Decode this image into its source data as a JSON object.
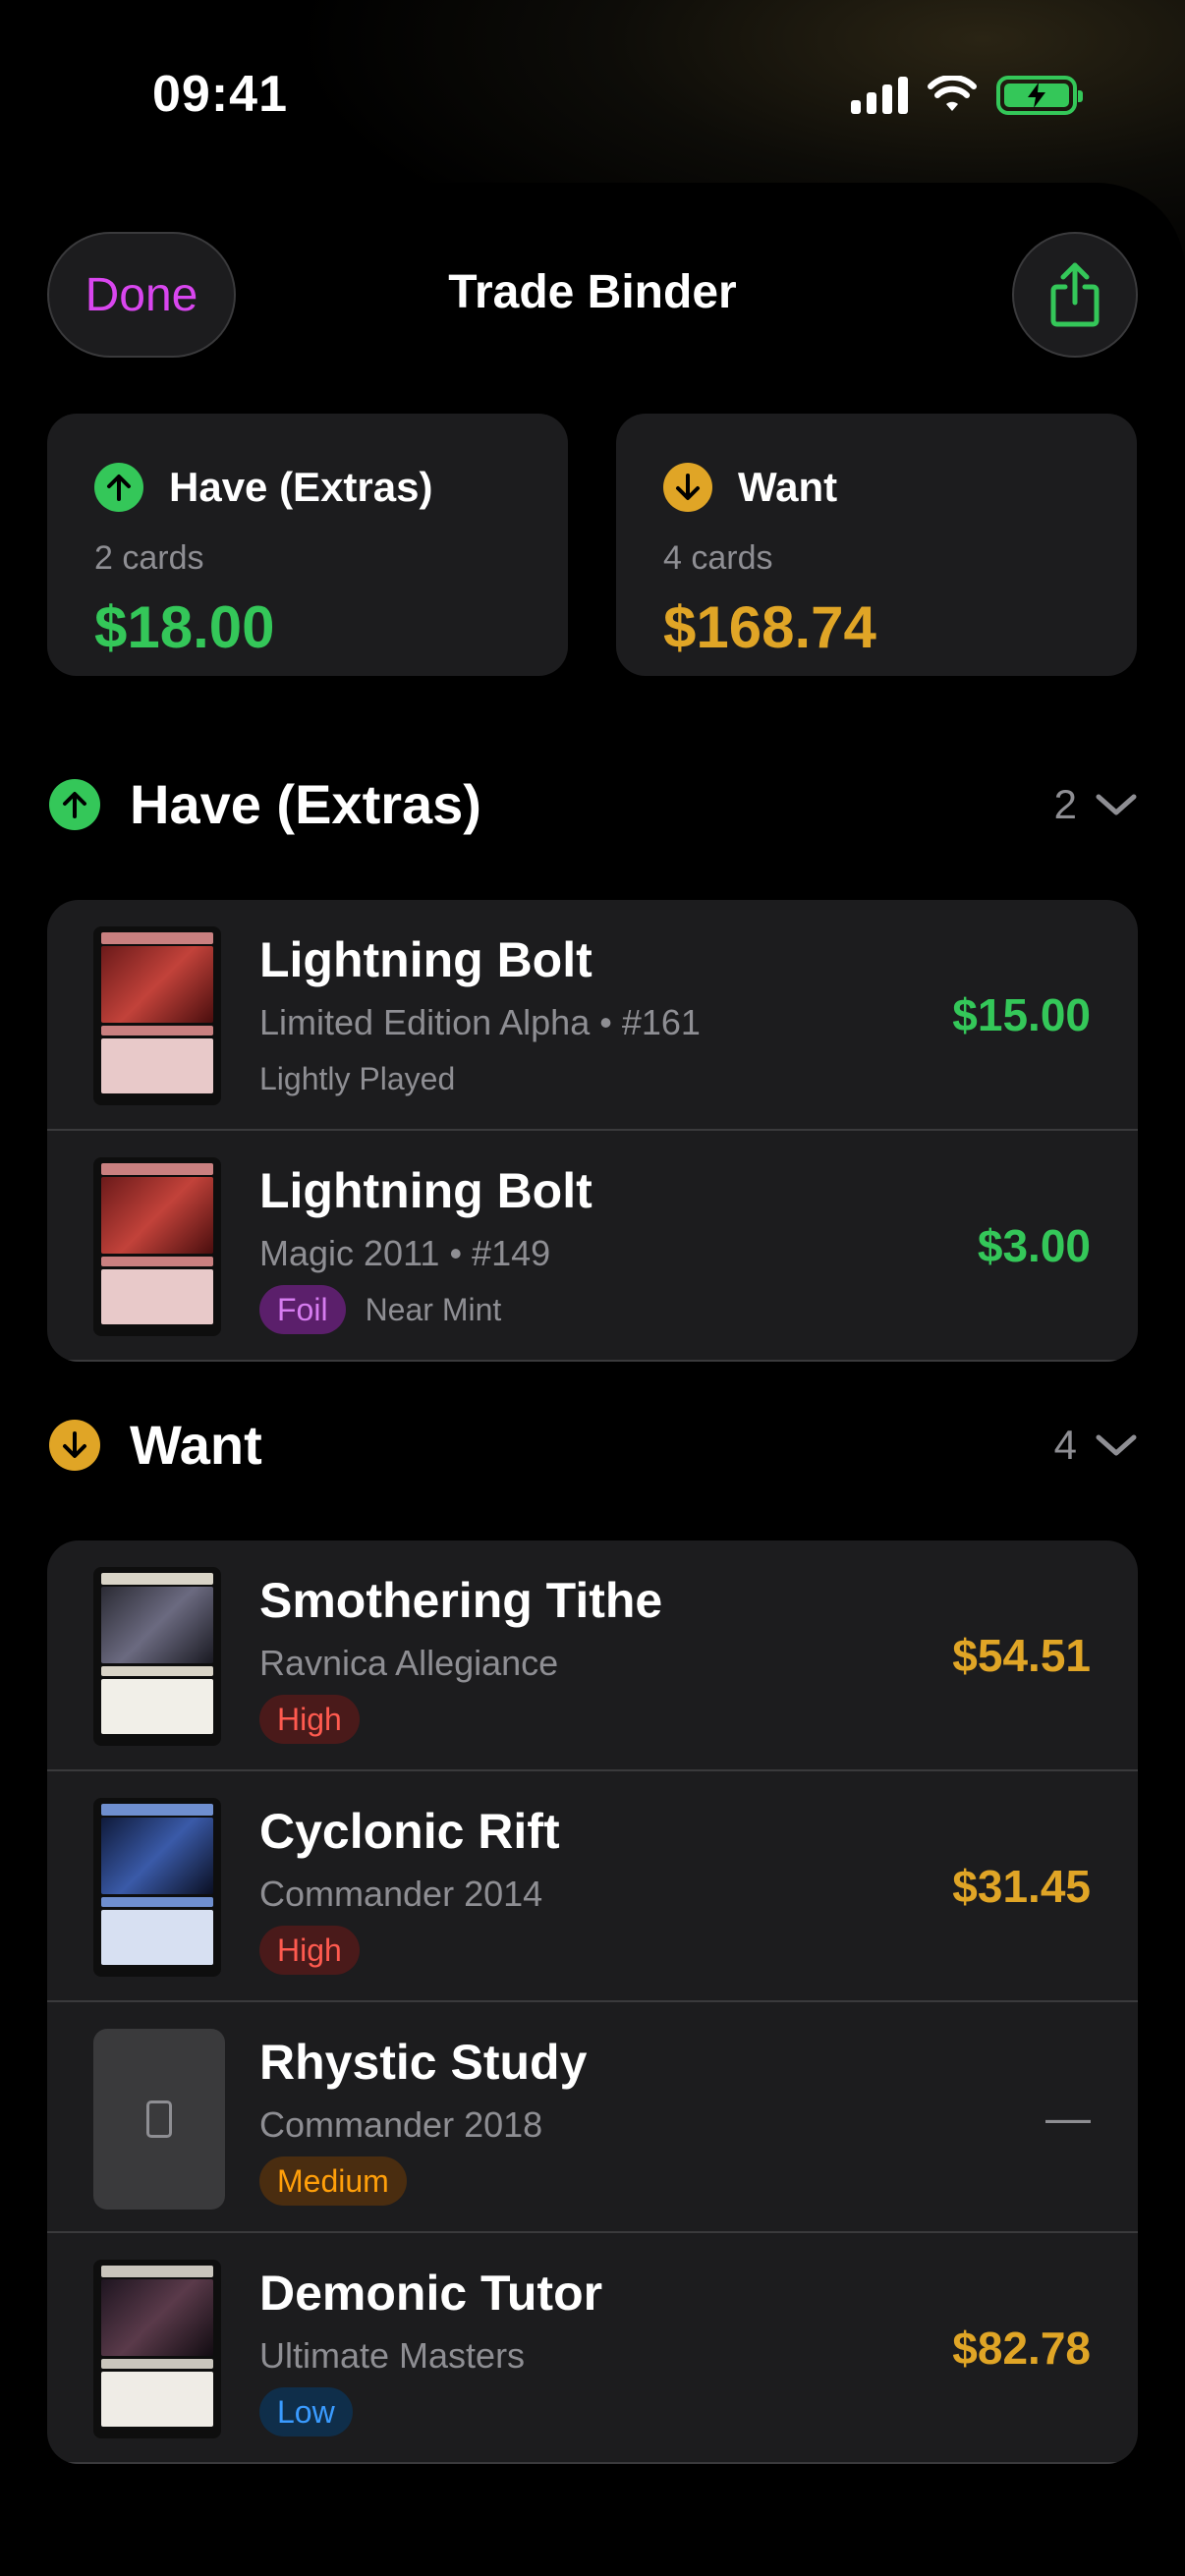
{
  "status": {
    "time": "09:41"
  },
  "nav": {
    "done_label": "Done",
    "title": "Trade Binder"
  },
  "summary": {
    "have": {
      "label": "Have (Extras)",
      "count": "2 cards",
      "value": "$18.00"
    },
    "want": {
      "label": "Want",
      "count": "4 cards",
      "value": "$168.74"
    }
  },
  "sections": {
    "have": {
      "title": "Have (Extras)",
      "count": "2",
      "items": [
        {
          "name": "Lightning Bolt",
          "set": "Limited Edition Alpha • #161",
          "condition": "Lightly Played",
          "price": "$15.00"
        },
        {
          "name": "Lightning Bolt",
          "set": "Magic 2011 • #149",
          "badge": "Foil",
          "condition": "Near Mint",
          "price": "$3.00"
        }
      ]
    },
    "want": {
      "title": "Want",
      "count": "4",
      "items": [
        {
          "name": "Smothering Tithe",
          "set": "Ravnica Allegiance",
          "priority": "High",
          "price": "$54.51"
        },
        {
          "name": "Cyclonic Rift",
          "set": "Commander 2014",
          "priority": "High",
          "price": "$31.45"
        },
        {
          "name": "Rhystic Study",
          "set": "Commander 2018",
          "priority": "Medium",
          "price": "—"
        },
        {
          "name": "Demonic Tutor",
          "set": "Ultimate Masters",
          "priority": "Low",
          "price": "$82.78"
        }
      ]
    }
  },
  "colors": {
    "accent_done": "#d946ef",
    "have_green": "#34c759",
    "want_gold": "#e0a526",
    "high_red": "#ff453a",
    "medium_orange": "#ff9f0a",
    "low_blue": "#0a84ff",
    "foil_purple": "#bf5af2"
  },
  "icons": {
    "have": "arrow-up-circle-icon",
    "want": "arrow-down-circle-icon",
    "share": "share-icon",
    "collapse": "chevron-down-icon",
    "placeholder": "card-placeholder-icon"
  }
}
